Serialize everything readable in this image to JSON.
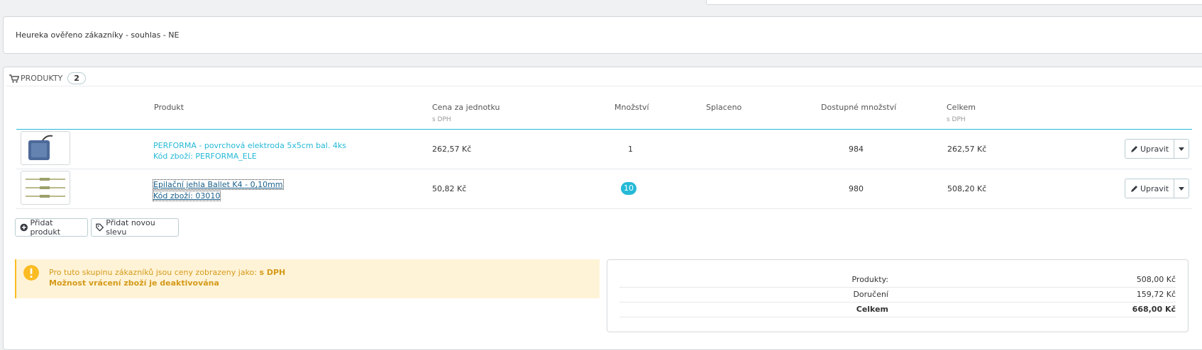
{
  "heureka_text": "Heureka ověřeno zákazníky - souhlas - NE",
  "products_panel": {
    "title": "PRODUKTY",
    "count": "2"
  },
  "table": {
    "headers": {
      "product": "Produkt",
      "unit_price": "Cena za jednotku",
      "unit_price_sub": "s DPH",
      "quantity": "Množství",
      "paid": "Splaceno",
      "available": "Dostupné množství",
      "total": "Celkem",
      "total_sub": "s DPH"
    },
    "rows": [
      {
        "name": "PERFORMA - povrchová elektroda 5x5cm bal. 4ks",
        "code": "Kód zboží: PERFORMA_ELE",
        "unit_price": "262,57 Kč",
        "quantity": "1",
        "available": "984",
        "total": "262,57 Kč",
        "edit_label": "Upravit"
      },
      {
        "name": "Epilační jehla Ballet K4 - 0,10mm",
        "code": "Kód zboží: 03010",
        "unit_price": "50,82 Kč",
        "quantity": "10",
        "available": "980",
        "total": "508,20 Kč",
        "edit_label": "Upravit"
      }
    ]
  },
  "buttons": {
    "add_product": "Přidat produkt",
    "add_discount": "Přidat novou slevu"
  },
  "alert": {
    "line1_prefix": "Pro tuto skupinu zákazníků jsou ceny zobrazeny jako:",
    "line1_bold": "s DPH",
    "line2": "Možnost vrácení zboží je deaktivována"
  },
  "totals": {
    "products_label": "Produkty:",
    "products_value": "508,00 Kč",
    "delivery_label": "Doručení",
    "delivery_value": "159,72 Kč",
    "total_label": "Celkem",
    "total_value": "668,00 Kč"
  },
  "colors": {
    "accent": "#25b9d7",
    "warning": "#fbbb22"
  }
}
